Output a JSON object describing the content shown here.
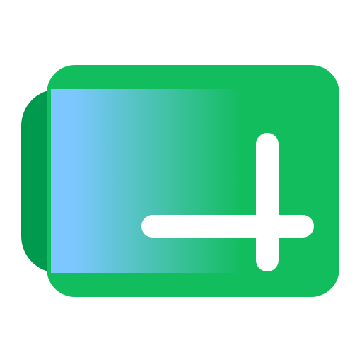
{
  "app_icon": {
    "icon_name": "new-tab-icon",
    "colors": {
      "background": "#ffffff",
      "card_back": "#009A4E",
      "card_front": "#12BD5E",
      "gradient_start": "#7CC7FF",
      "gradient_end": "#12BD5E",
      "plus": "#FFFFFF"
    }
  }
}
